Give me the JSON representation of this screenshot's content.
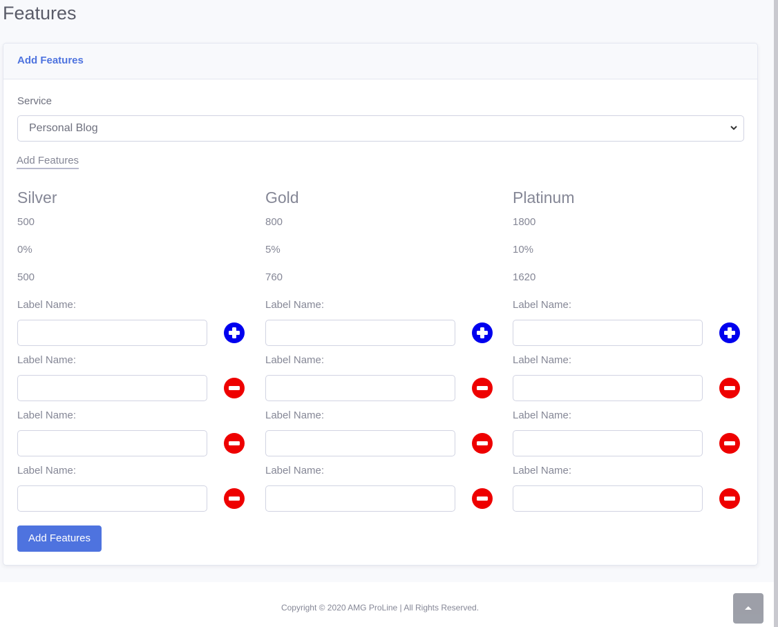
{
  "page": {
    "title": "Features"
  },
  "card": {
    "header": "Add Features"
  },
  "form": {
    "service_label": "Service",
    "service_selected": "Personal Blog",
    "sub_link": "Add Features",
    "submit_label": "Add Features"
  },
  "plans": [
    {
      "name": "Silver",
      "values": [
        "500",
        "0%",
        "500"
      ]
    },
    {
      "name": "Gold",
      "values": [
        "800",
        "5%",
        "760"
      ]
    },
    {
      "name": "Platinum",
      "values": [
        "1800",
        "10%",
        "1620"
      ]
    }
  ],
  "feature_rows": [
    {
      "label": "Label Name:",
      "action": "add"
    },
    {
      "label": "Label Name:",
      "action": "remove"
    },
    {
      "label": "Label Name:",
      "action": "remove"
    },
    {
      "label": "Label Name:",
      "action": "remove"
    }
  ],
  "footer": {
    "copyright": "Copyright © 2020 AMG ProLine | All Rights Reserved."
  },
  "colors": {
    "primary": "#4e73df",
    "add_icon": "#0000ee",
    "remove_icon": "#ee0000"
  },
  "icons": {
    "add": "plus-circle-icon",
    "remove": "minus-circle-icon",
    "scroll_top": "chevron-up-icon",
    "select": "chevron-down-icon"
  }
}
